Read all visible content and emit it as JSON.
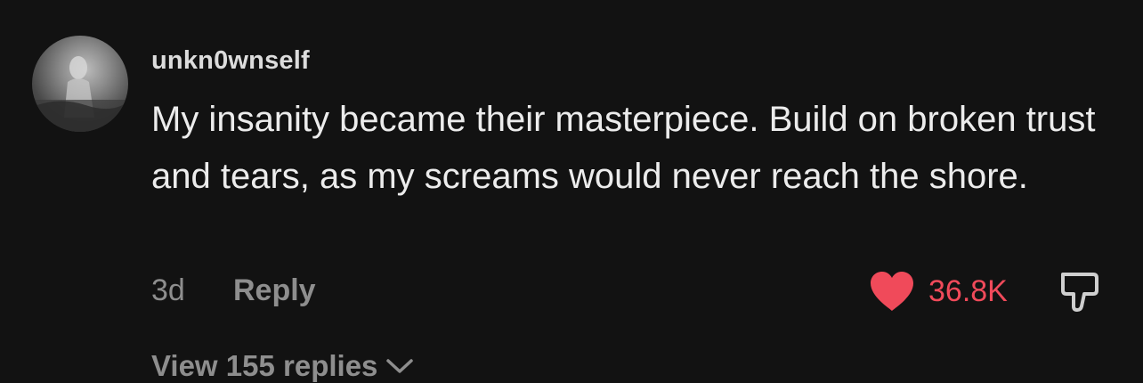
{
  "comment": {
    "username": "unkn0wnself",
    "text": "My insanity became their masterpiece. Build on broken trust and tears, as my screams would never reach the shore.",
    "age": "3d",
    "reply_label": "Reply",
    "like_count": "36.8K",
    "view_replies_label": "View 155 replies"
  },
  "colors": {
    "background": "#121212",
    "text": "#ececec",
    "muted": "#8e8e8e",
    "like": "#f04a5a"
  },
  "icons": {
    "avatar": "avatar",
    "like": "heart-icon",
    "dislike": "thumbs-down-icon",
    "expand": "chevron-down-icon"
  }
}
